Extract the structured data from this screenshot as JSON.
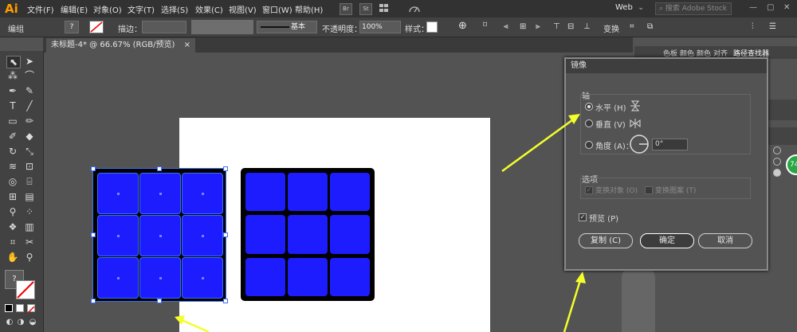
{
  "app": {
    "logo": "Ai",
    "menus": [
      "文件(F)",
      "编辑(E)",
      "对象(O)",
      "文字(T)",
      "选择(S)",
      "效果(C)",
      "视图(V)",
      "窗口(W)",
      "帮助(H)"
    ],
    "bridge_label": "Br",
    "stock_label": "St",
    "workspace": "Web",
    "search_placeholder": "搜索 Adobe Stock"
  },
  "control_bar": {
    "group_label": "编组",
    "stroke_label": "描边：",
    "stroke_style": "基本",
    "opacity_label": "不透明度：",
    "opacity_value": "100%",
    "style_label": "样式：",
    "transform_label": "变换"
  },
  "document": {
    "tab_title": "未标题-4* @ 66.67% (RGB/预览)",
    "tab_close": "×"
  },
  "right_panel": {
    "tabs": [
      "色板",
      "颜色",
      "颜色",
      "对齐",
      "路径查找器"
    ],
    "badge": "74"
  },
  "dialog": {
    "title": "镜像",
    "axis_group": "轴",
    "horizontal": "水平 (H)",
    "vertical": "垂直 (V)",
    "angle": "角度 (A)：",
    "angle_value": "0°",
    "options_group": "选项",
    "transform_objects": "变换对象 (O)",
    "transform_patterns": "变换图案 (T)",
    "preview": "预览 (P)",
    "copy_button": "复制 (C)",
    "ok_button": "确定",
    "cancel_button": "取消"
  },
  "colors": {
    "square_fill": "#1c1cff",
    "square_stroke": "#000000",
    "arrow": "#f3ff2a"
  },
  "grids": [
    {
      "name": "original-grid",
      "rows": 3,
      "cols": 3,
      "selected": true
    },
    {
      "name": "mirrored-grid",
      "rows": 3,
      "cols": 3,
      "selected": false
    }
  ]
}
